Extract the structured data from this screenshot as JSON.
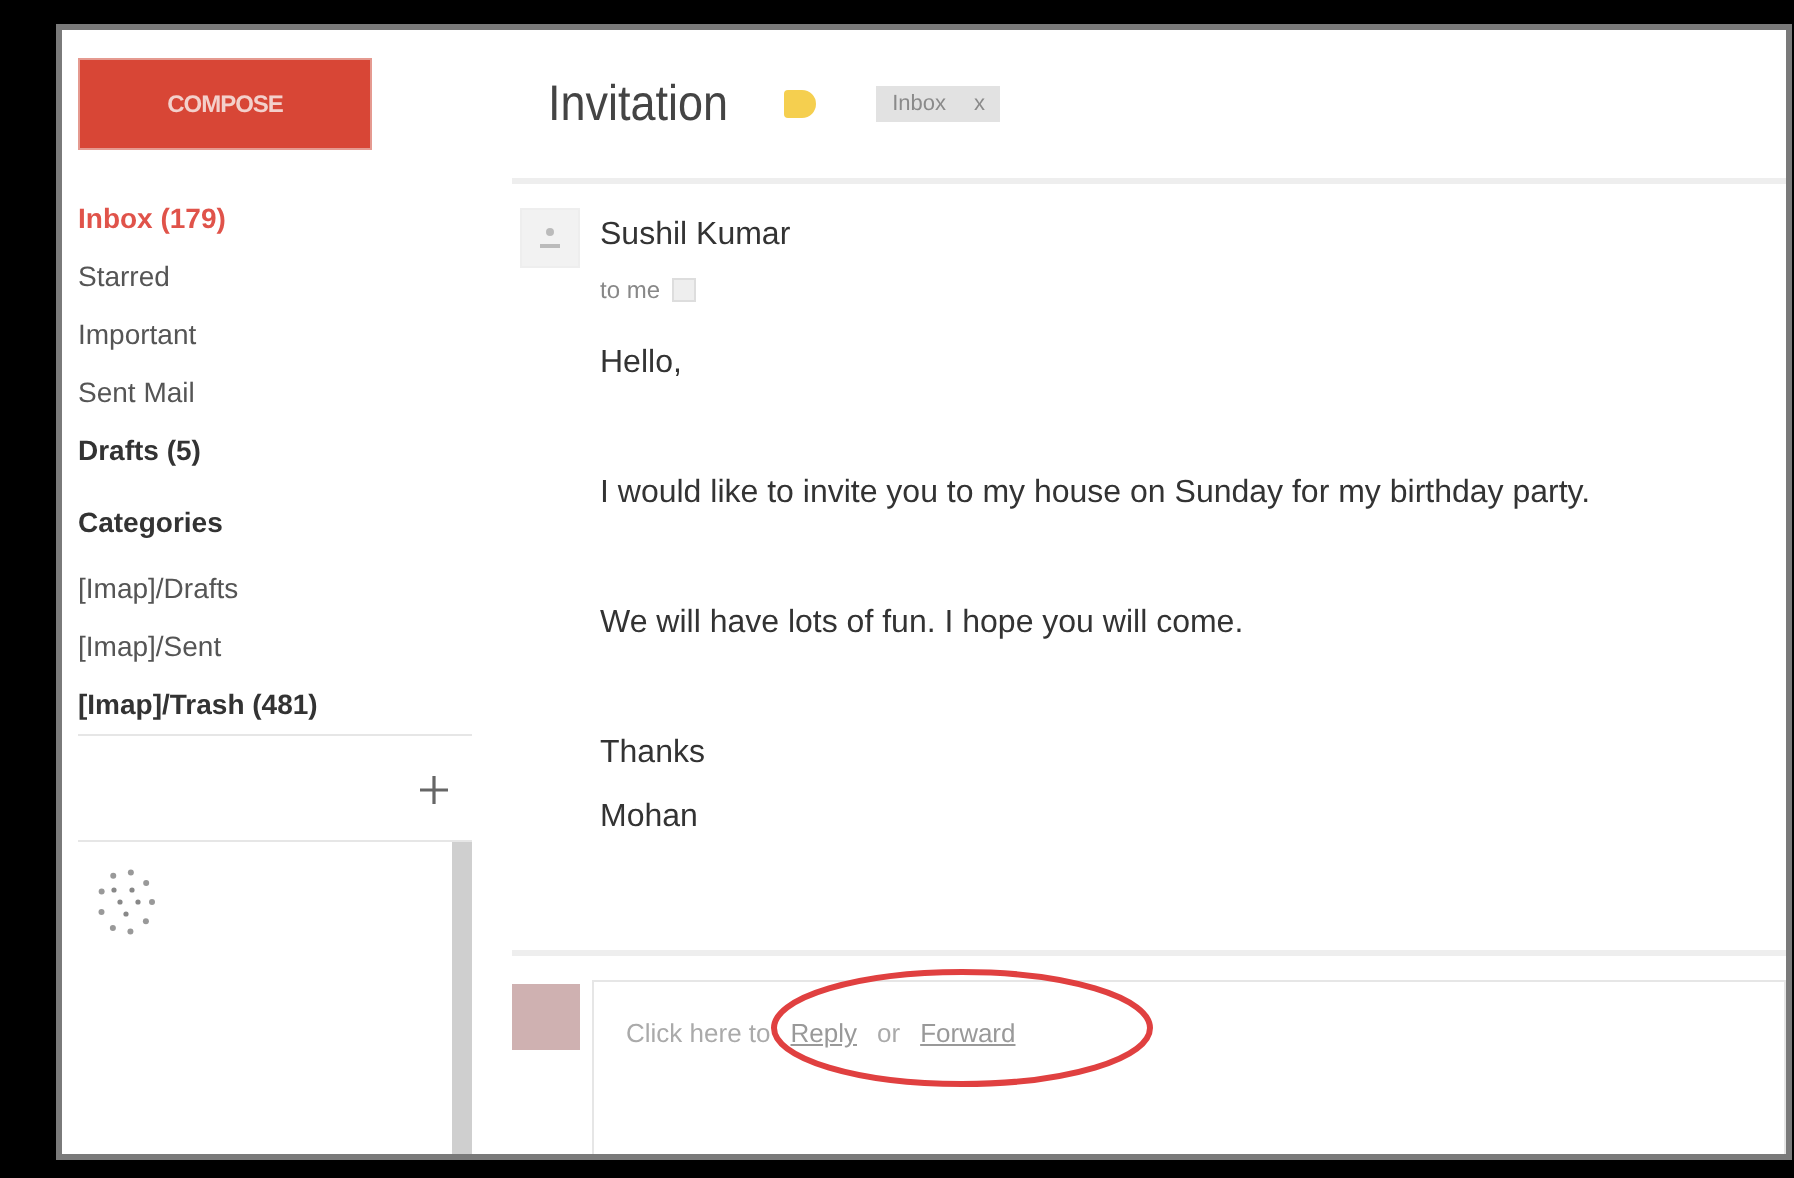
{
  "sidebar": {
    "compose": "COMPOSE",
    "folders": [
      {
        "label": "Inbox (179)",
        "selected": true,
        "bold": true
      },
      {
        "label": "Starred",
        "selected": false,
        "bold": false
      },
      {
        "label": "Important",
        "selected": false,
        "bold": false
      },
      {
        "label": "Sent Mail",
        "selected": false,
        "bold": false
      },
      {
        "label": "Drafts (5)",
        "selected": false,
        "bold": true
      }
    ],
    "categories": "Categories",
    "labels": [
      {
        "label": "[Imap]/Drafts",
        "selected": false,
        "bold": false
      },
      {
        "label": "[Imap]/Sent",
        "selected": false,
        "bold": false
      },
      {
        "label": "[Imap]/Trash (481)",
        "selected": false,
        "bold": true
      }
    ]
  },
  "message": {
    "subject": "Invitation",
    "label_chip": {
      "label": "Inbox",
      "close": "x"
    },
    "sender": "Sushil Kumar",
    "recipient": "to me",
    "body": [
      "Hello,",
      "I would like to invite you to my house on Sunday for my birthday party.",
      "We will have lots of fun. I hope you will come.",
      "Thanks",
      "Mohan"
    ]
  },
  "reply": {
    "prompt": [
      {
        "kind": "text",
        "text": "Click here to"
      },
      {
        "kind": "link",
        "text": "Reply"
      },
      {
        "kind": "text",
        "text": "or"
      },
      {
        "kind": "link",
        "text": "Forward"
      }
    ],
    "highlighted": true
  }
}
